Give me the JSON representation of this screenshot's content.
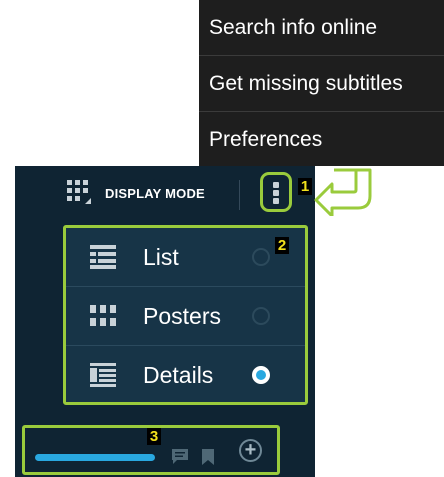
{
  "overflow_menu": {
    "items": [
      {
        "label": "Search info online"
      },
      {
        "label": "Get missing subtitles"
      },
      {
        "label": "Preferences"
      }
    ]
  },
  "action_bar": {
    "display_mode_label": "DISPLAY MODE",
    "display_mode_icon": "grid-icon",
    "overflow_icon": "overflow-menu-icon"
  },
  "badges": {
    "one": "1",
    "two": "2",
    "three": "3"
  },
  "view_modes": [
    {
      "label": "List",
      "icon": "list-icon",
      "selected": false
    },
    {
      "label": "Posters",
      "icon": "posters-grid-icon",
      "selected": false
    },
    {
      "label": "Details",
      "icon": "details-icon",
      "selected": true
    }
  ],
  "bottom_bar": {
    "progress_icon": "progress-bar",
    "comment_icon": "comment-icon",
    "bookmark_icon": "bookmark-icon",
    "add_icon": "add-circle-icon"
  },
  "colors": {
    "highlight": "#9acb3c",
    "accent": "#29a8e0",
    "panel": "#0f2433",
    "menu": "#1e1e1e",
    "badge_text": "#f2e01c"
  }
}
